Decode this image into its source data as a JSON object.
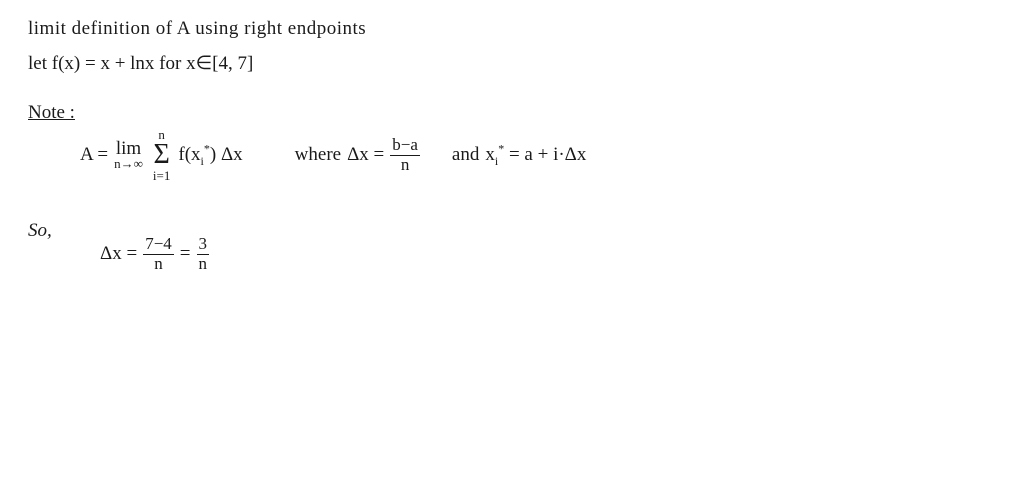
{
  "title": {
    "line1": "limit definition of  A   using  right  endpoints",
    "line2": "let  f(x) =  x + lnx       for   x∈[4, 7]",
    "note": "Note :"
  },
  "formula": {
    "A_equals": "A =",
    "lim_text": "lim",
    "lim_sub": "n→∞",
    "sigma_top": "n",
    "sigma_sym": "Σ",
    "sigma_bot": "i=1",
    "fx": "f(x",
    "i_star": "i",
    "star": "*",
    "close_fx": ") Δx",
    "where": "where",
    "delta_x": "Δx =",
    "frac_numer": "b−a",
    "frac_denom": "n",
    "and": "and",
    "xi_star": "x",
    "xi_sub": "i",
    "xi_sup": "*",
    "equals_a": "= a + i·Δx"
  },
  "so": {
    "label": "So,",
    "delta": "Δx =",
    "frac2_numer": "7−4",
    "frac2_denom": "n",
    "equals": "=",
    "result_numer": "3",
    "result_denom": "n"
  },
  "colors": {
    "text": "#1a1a1a",
    "bg": "#ffffff"
  }
}
